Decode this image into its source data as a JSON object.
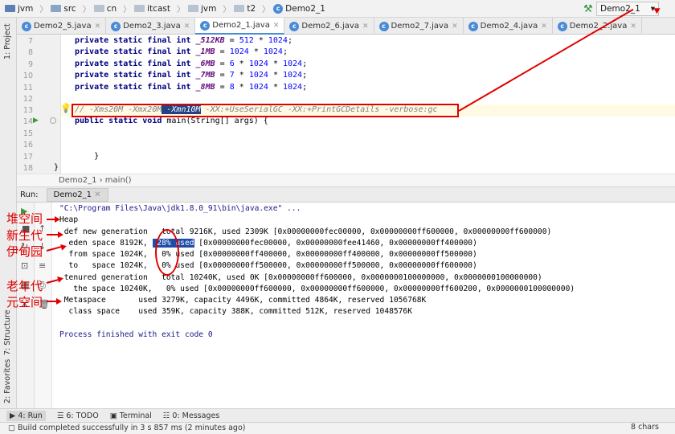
{
  "breadcrumb": [
    "jvm",
    "src",
    "cn",
    "itcast",
    "jvm",
    "t2",
    "Demo2_1"
  ],
  "run_config": "Demo2_1",
  "tabs": [
    {
      "label": "Demo2_5.java",
      "active": false
    },
    {
      "label": "Demo2_3.java",
      "active": false
    },
    {
      "label": "Demo2_1.java",
      "active": true
    },
    {
      "label": "Demo2_6.java",
      "active": false
    },
    {
      "label": "Demo2_7.java",
      "active": false
    },
    {
      "label": "Demo2_4.java",
      "active": false
    },
    {
      "label": "Demo2_2.java",
      "active": false
    }
  ],
  "side_labels": {
    "project": "1: Project",
    "structure": "7: Structure",
    "favorites": "2: Favorites"
  },
  "code": {
    "line_numbers": [
      "7",
      "8",
      "9",
      "10",
      "11",
      "12",
      "13",
      "14",
      "15",
      "16",
      "17",
      "18"
    ],
    "kw": "private static final int",
    "l7_name": "_512KB",
    "l7_val": "512",
    "l7_op": "*",
    "l7_num": "1024",
    "l8_name": "_1MB",
    "l8_val": "1024",
    "l8_op": "*",
    "l8_num": "1024",
    "l9_name": "_6MB",
    "l9_val": "6",
    "l9_op": "*",
    "l9_mid": "1024",
    "l9_num": "1024",
    "l10_name": "_7MB",
    "l10_val": "7",
    "l10_op": "*",
    "l10_mid": "1024",
    "l10_num": "1024",
    "l11_name": "_8MB",
    "l11_val": "8",
    "l11_op": "*",
    "l11_mid": "1024",
    "l11_num": "1024",
    "l13_prefix": "// -Xms20M -Xmx20M",
    "l13_selected": " -Xmn10M",
    "l13_suffix": " -XX:+UseSerialGC -XX:+PrintGCDetails -verbose:gc",
    "l14_kw": "public static void",
    "l14_rest": " main(String[] args) {",
    "l17": "}",
    "l18": "}"
  },
  "editor_breadcrumb": "Demo2_1  ›  main()",
  "run_panel": {
    "label": "Run:",
    "tab": "Demo2_1"
  },
  "console": {
    "cmd": "\"C:\\Program Files\\Java\\jdk1.8.0_91\\bin\\java.exe\" ...",
    "heap": "Heap",
    "def_new": " def new generation   total 9216K, used 2309K [0x00000000fec00000, 0x00000000ff600000, 0x00000000ff600000)",
    "eden_a": "  eden space 8192K, ",
    "eden_pct": " 28% used",
    "eden_b": " [0x00000000fec00000, 0x00000000fee41460, 0x00000000ff400000)",
    "from": "  from space 1024K,   0% used [0x00000000ff400000, 0x00000000ff400000, 0x00000000ff500000)",
    "to": "  to   space 1024K,   0% used [0x00000000ff500000, 0x00000000ff500000, 0x00000000ff600000)",
    "tenured": " tenured generation   total 10240K, used 0K [0x00000000ff600000, 0x0000000100000000, 0x0000000100000000)",
    "the_space": "   the space 10240K,   0% used [0x00000000ff600000, 0x00000000ff600000, 0x00000000ff600200, 0x0000000100000000)",
    "metaspace": " Metaspace       used 3279K, capacity 4496K, committed 4864K, reserved 1056768K",
    "class_space": "  class space    used 359K, capacity 388K, committed 512K, reserved 1048576K",
    "finished": "Process finished with exit code 0"
  },
  "annotations": {
    "heap": "堆空间",
    "young": "新生代",
    "eden": "伊甸园",
    "old": "老年代",
    "meta": "元空间"
  },
  "bottom_tabs": [
    "4: Run",
    "6: TODO",
    "Terminal",
    "0: Messages"
  ],
  "status": "Build completed successfully in 3 s 857 ms (2 minutes ago)",
  "chars": "8 chars",
  "colors": {
    "annotation": "#e00000",
    "selection": "#214283",
    "accent": "#4a8bd6"
  }
}
